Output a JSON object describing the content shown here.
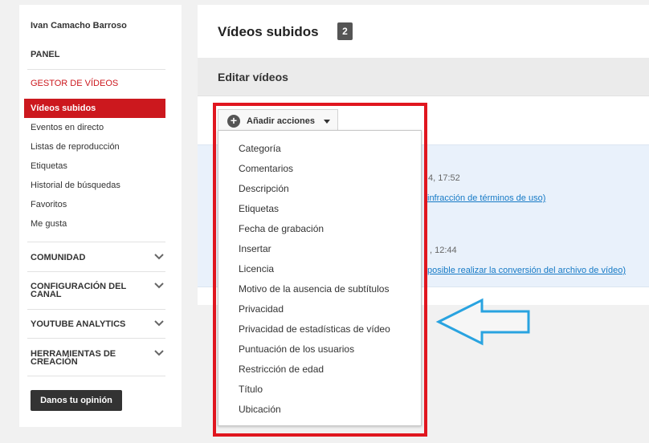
{
  "sidebar": {
    "user_name": "Ivan Camacho Barroso",
    "panel": "PANEL",
    "video_manager": "GESTOR DE VÍDEOS",
    "active_item": "Vídeos subidos",
    "links": [
      "Eventos en directo",
      "Listas de reproducción",
      "Etiquetas",
      "Historial de búsquedas",
      "Favoritos",
      "Me gusta"
    ],
    "sections": [
      "COMUNIDAD",
      "CONFIGURACIÓN DEL CANAL",
      "YOUTUBE ANALYTICS",
      "HERRAMIENTAS DE CREACIÓN"
    ],
    "feedback_button": "Danos tu opinión"
  },
  "header": {
    "title": "Vídeos subidos",
    "count": "2"
  },
  "edit_bar": {
    "title": "Editar vídeos"
  },
  "actions": {
    "button_label": "Añadir acciones",
    "menu_items": [
      "Categoría",
      "Comentarios",
      "Descripción",
      "Etiquetas",
      "Fecha de grabación",
      "Insertar",
      "Licencia",
      "Motivo de la ausencia de subtítulos",
      "Privacidad",
      "Privacidad de estadísticas de vídeo",
      "Puntuación de los usuarios",
      "Restricción de edad",
      "Título",
      "Ubicación"
    ]
  },
  "videos": [
    {
      "date_fragment": "4, 17:52",
      "status_fragment": "infracción de términos de uso)"
    },
    {
      "date_fragment": ", 12:44",
      "status_fragment": "posible realizar la conversión del archivo de vídeo)"
    }
  ],
  "icons": {
    "plus": "plus-circle-icon",
    "caret": "caret-down-icon",
    "chevron": "chevron-down-icon",
    "arrow": "arrow-left-outline-icon"
  },
  "colors": {
    "accent_red": "#cc181e",
    "highlight_frame": "#e0161f",
    "annotation_arrow": "#29a3e0",
    "link_blue": "#167ac6"
  }
}
